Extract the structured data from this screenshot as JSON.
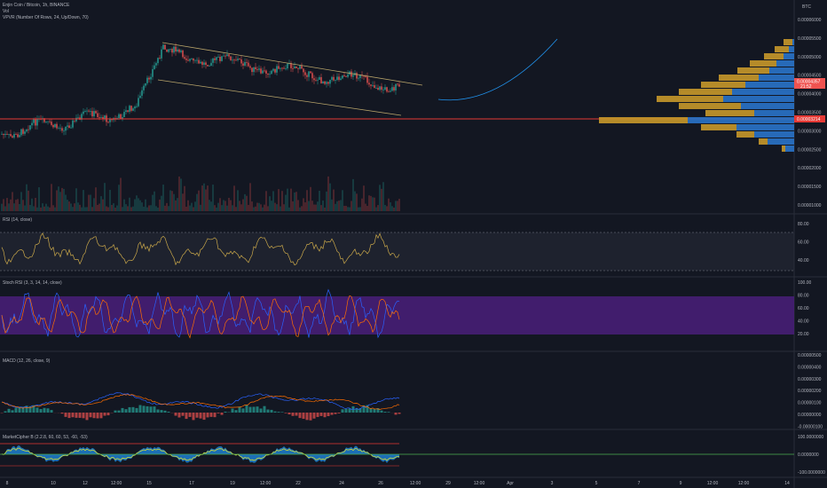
{
  "header": {
    "symbol": "Enjin Coin / Bitcoin, 1h, BINANCE",
    "vol": "Vol",
    "vpvr": "VPVR (Number Of Rows, 24, Up/Down, 70)",
    "currency": "BTC"
  },
  "price_axis": [
    "0.00006000",
    "0.00005500",
    "0.00005000",
    "0.00004500",
    "0.00004000",
    "0.00003500",
    "0.00003000",
    "0.00002500",
    "0.00002000",
    "0.00001500",
    "0.00001000"
  ],
  "price_tags": {
    "last": "0.00004357",
    "last_sub": "21:52",
    "line": "0.00003214"
  },
  "rsi": {
    "title": "RSI (14, close)",
    "axis": [
      "80.00",
      "60.00",
      "40.00"
    ]
  },
  "stoch": {
    "title": "Stoch RSI (3, 3, 14, 14, close)",
    "axis": [
      "100.00",
      "80.00",
      "60.00",
      "40.00",
      "20.00"
    ]
  },
  "macd": {
    "title": "MACD (12, 26, close, 9)",
    "axis": [
      "0.00000500",
      "0.00000400",
      "0.00000300",
      "0.00000200",
      "0.00000100",
      "0.00000000",
      "-0.00000100"
    ]
  },
  "cipher": {
    "title": "MarketCipher B (2.2.8, 60, 60, 53, -60, -53)",
    "axis": [
      "100.0000000",
      "0.0000000",
      "-100.0000000"
    ]
  },
  "time_axis": [
    "8",
    "10",
    "12",
    "12:00",
    "15",
    "17",
    "19",
    "12:00",
    "22",
    "24",
    "26",
    "12:00",
    "29",
    "12:00",
    "Apr",
    "3",
    "5",
    "7",
    "9",
    "12:00",
    "12:00",
    "14"
  ],
  "colors": {
    "bg": "#131722",
    "up": "#26a69a",
    "down": "#ef5350",
    "red_line": "#e53935",
    "rsi": "#c9a74a",
    "stoch_band": "#4a1f7a",
    "k": "#2962ff",
    "d": "#ff6d00",
    "curve": "#2196f3",
    "vp_up": "#2a73c9",
    "vp_down": "#c8982a"
  }
}
